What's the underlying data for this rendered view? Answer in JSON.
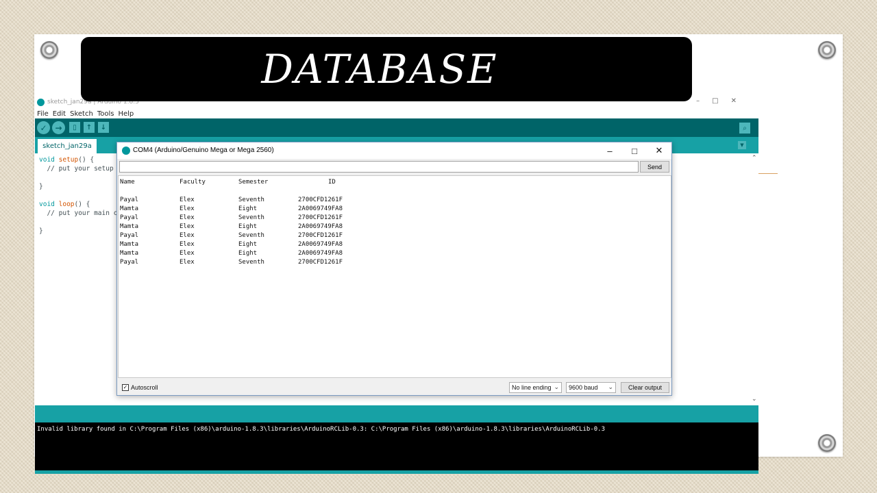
{
  "slide": {
    "title": "DATABASE"
  },
  "ide": {
    "window_title": "sketch_jan29a | Arduino 1.8.3",
    "menu": [
      "File",
      "Edit",
      "Sketch",
      "Tools",
      "Help"
    ],
    "tab_label": "sketch_jan29a",
    "code": {
      "l1_kw": "void",
      "l1_fn": "setup",
      "l1_rest": "() {",
      "l2": "  // put your setup c",
      "l3": "}",
      "l4_kw": "void",
      "l4_fn": "loop",
      "l4_rest": "() {",
      "l5": "  // put your main co",
      "l6": "}"
    },
    "console_text": "Invalid library found in C:\\Program Files (x86)\\arduino-1.8.3\\libraries\\ArduinoRCLib-0.3: C:\\Program Files (x86)\\arduino-1.8.3\\libraries\\ArduinoRCLib-0.3"
  },
  "serial_monitor": {
    "title": "COM4 (Arduino/Genuino Mega or Mega 2560)",
    "input_value": "",
    "send_label": "Send",
    "output": {
      "headers": [
        "Name",
        "Faculty",
        "Semester",
        "ID"
      ],
      "rows": [
        [
          "Payal",
          "Elex",
          "Seventh",
          "2700CFD1261F"
        ],
        [
          "Mamta",
          "Elex",
          "Eight",
          "2A0069749FA8"
        ],
        [
          "Payal",
          "Elex",
          "Seventh",
          "2700CFD1261F"
        ],
        [
          "Mamta",
          "Elex",
          "Eight",
          "2A0069749FA8"
        ],
        [
          "Payal",
          "Elex",
          "Seventh",
          "2700CFD1261F"
        ],
        [
          "Mamta",
          "Elex",
          "Eight",
          "2A0069749FA8"
        ],
        [
          "Mamta",
          "Elex",
          "Eight",
          "2A0069749FA8"
        ],
        [
          "Payal",
          "Elex",
          "Seventh",
          "2700CFD1261F"
        ]
      ]
    },
    "autoscroll_label": "Autoscroll",
    "autoscroll_checked": true,
    "line_ending": "No line ending",
    "baud": "9600 baud",
    "clear_label": "Clear output"
  },
  "colors": {
    "arduino_teal_dark": "#006468",
    "arduino_teal": "#17a1a5",
    "title_bg": "#000000"
  }
}
